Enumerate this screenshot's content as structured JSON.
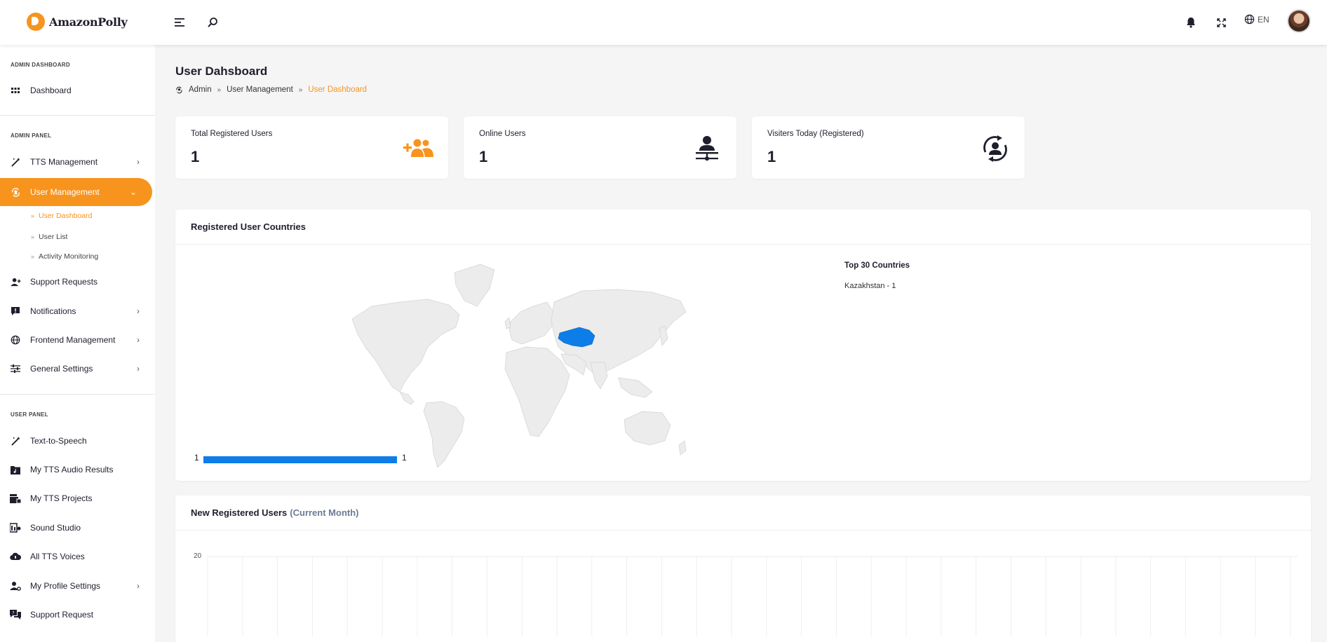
{
  "app": {
    "name": "AmazonPolly"
  },
  "header": {
    "lang": "EN"
  },
  "sidebar": {
    "sections": [
      {
        "title": "ADMIN DASHBOARD"
      },
      {
        "title": "ADMIN PANEL"
      },
      {
        "title": "USER PANEL"
      }
    ],
    "items": [
      {
        "label": "Dashboard",
        "icon": "grid-icon"
      },
      {
        "label": "TTS Management",
        "icon": "magic-wand-icon"
      },
      {
        "label": "User Management",
        "icon": "user-sync-icon"
      },
      {
        "label": "Support Requests",
        "icon": "user-plus-icon"
      },
      {
        "label": "Notifications",
        "icon": "alert-message-icon"
      },
      {
        "label": "Frontend Management",
        "icon": "globe-icon"
      },
      {
        "label": "General Settings",
        "icon": "sliders-icon"
      },
      {
        "label": "Text-to-Speech",
        "icon": "magic-wand-icon"
      },
      {
        "label": "My TTS Audio Results",
        "icon": "music-folder-icon"
      },
      {
        "label": "My TTS Projects",
        "icon": "projects-icon"
      },
      {
        "label": "Sound Studio",
        "icon": "studio-icon"
      },
      {
        "label": "All TTS Voices",
        "icon": "cloud-voice-icon"
      },
      {
        "label": "My Profile Settings",
        "icon": "user-settings-icon"
      },
      {
        "label": "Support Request",
        "icon": "support-icon"
      }
    ],
    "submenu": [
      {
        "label": "User Dashboard"
      },
      {
        "label": "User List"
      },
      {
        "label": "Activity Monitoring"
      }
    ]
  },
  "page": {
    "title": "User Dahsboard",
    "breadcrumb": [
      "Admin",
      "User Management",
      "User Dashboard"
    ]
  },
  "stats": [
    {
      "label": "Total Registered Users",
      "value": "1",
      "icon": "users-plus-icon"
    },
    {
      "label": "Online Users",
      "value": "1",
      "icon": "user-online-icon"
    },
    {
      "label": "Visiters Today (Registered)",
      "value": "1",
      "icon": "user-refresh-icon"
    }
  ],
  "countries_panel": {
    "title": "Registered User Countries",
    "top_title": "Top 30 Countries",
    "items": [
      "Kazakhstan - 1"
    ],
    "legend_min": "1",
    "legend_max": "1",
    "highlight_color": "#0d7de8"
  },
  "new_users_panel": {
    "title": "New Registered Users",
    "subtitle": "(Current Month)",
    "y_tick": "20"
  },
  "colors": {
    "accent": "#f7941d",
    "dark": "#1e1e2d",
    "map_highlight": "#0d7de8"
  }
}
